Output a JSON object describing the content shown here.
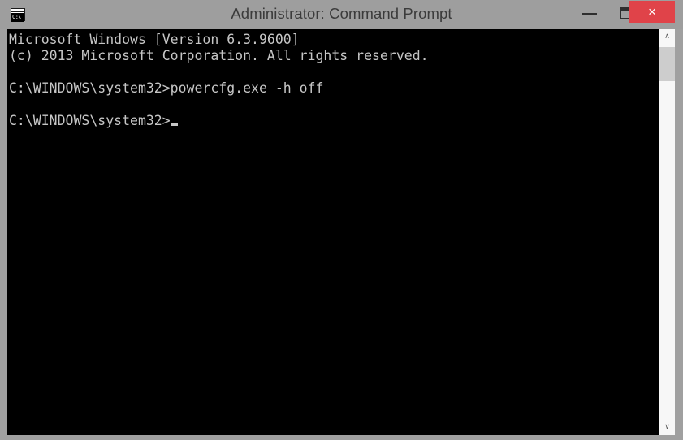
{
  "window": {
    "title": "Administrator: Command Prompt",
    "icon_name": "command-prompt-icon",
    "icon_glyph": "C:\\",
    "titlebar_color": "#9e9e9e",
    "close_button_color": "#e04349"
  },
  "controls": {
    "minimize_label": "–",
    "maximize_label": "❐",
    "close_label": "×"
  },
  "console": {
    "background_color": "#000000",
    "text_color": "#c6c6c6",
    "lines": [
      "Microsoft Windows [Version 6.3.9600]",
      "(c) 2013 Microsoft Corporation. All rights reserved.",
      "",
      "C:\\WINDOWS\\system32>powercfg.exe -h off",
      "",
      "C:\\WINDOWS\\system32>"
    ],
    "prompt_line_index": 5,
    "cursor": "_"
  },
  "scrollbar": {
    "up_arrow": "∧",
    "down_arrow": "∨",
    "thumb_color": "#cdcdcd",
    "track_color": "#f7f7f7"
  }
}
